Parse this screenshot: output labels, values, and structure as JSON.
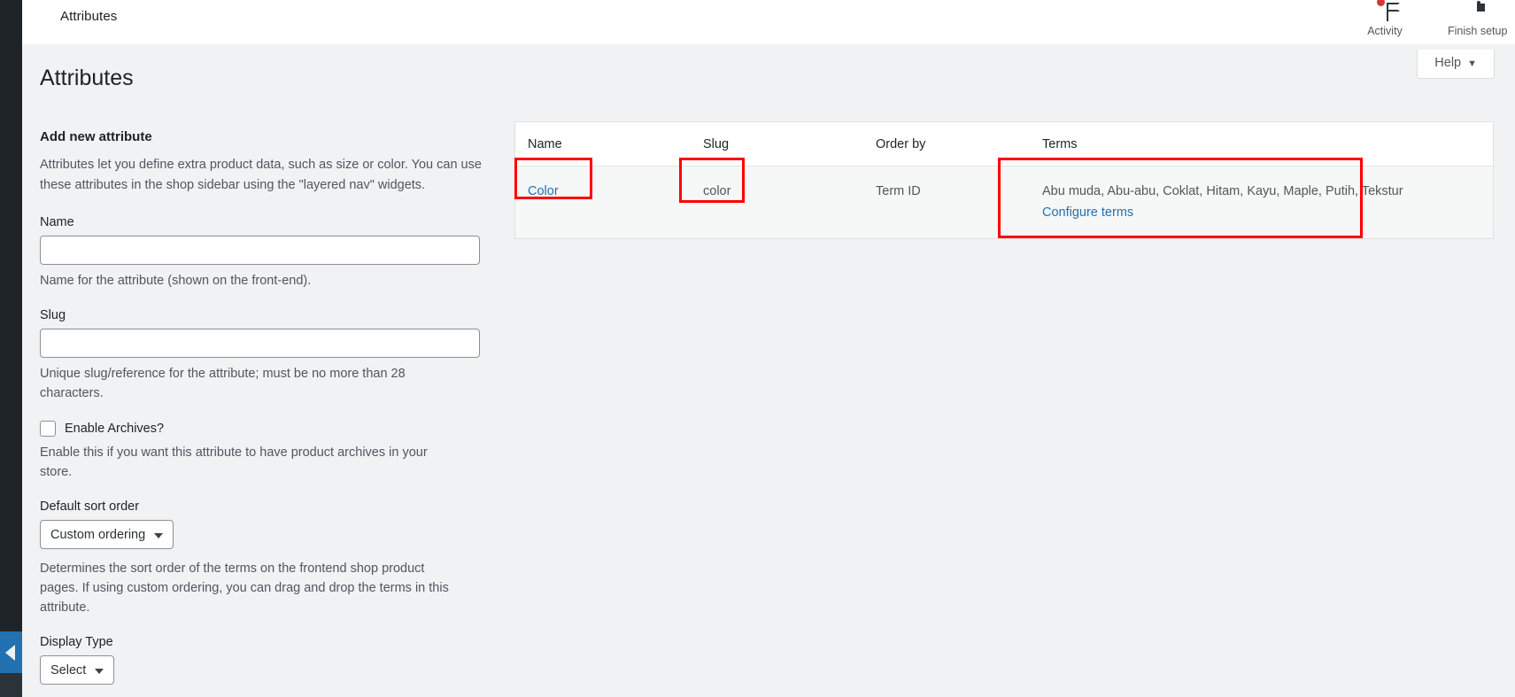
{
  "window": {
    "breadcrumb_title": "Attributes"
  },
  "topbar": {
    "actions": [
      {
        "icon": "flag-icon",
        "label": "Activity",
        "badge": true
      },
      {
        "icon": "setup-progress-icon",
        "label": "Finish setup",
        "badge": false
      }
    ]
  },
  "help": {
    "label": "Help",
    "caret": "▼"
  },
  "page": {
    "title": "Attributes"
  },
  "form": {
    "heading": "Add new attribute",
    "description": "Attributes let you define extra product data, such as size or color. You can use these attributes in the shop sidebar using the \"layered nav\" widgets.",
    "name_label": "Name",
    "name_value": "",
    "name_placeholder": "",
    "name_hint": "Name for the attribute (shown on the front-end).",
    "slug_label": "Slug",
    "slug_value": "",
    "slug_placeholder": "",
    "slug_hint": "Unique slug/reference for the attribute; must be no more than 28 characters.",
    "enable_archives_label": "Enable Archives?",
    "enable_archives_checked": false,
    "enable_archives_hint": "Enable this if you want this attribute to have product archives in your store.",
    "sort_order_label": "Default sort order",
    "sort_order_value": "Custom ordering",
    "sort_order_hint": "Determines the sort order of the terms on the frontend shop product pages. If using custom ordering, you can drag and drop the terms in this attribute.",
    "display_type_label": "Display Type",
    "display_type_value": "Select"
  },
  "table": {
    "headers": {
      "name": "Name",
      "slug": "Slug",
      "order_by": "Order by",
      "terms": "Terms"
    },
    "rows": [
      {
        "name": "Color",
        "slug": "color",
        "order_by": "Term ID",
        "terms": "Abu muda, Abu-abu, Coklat, Hitam, Kayu, Maple, Putih, Tekstur",
        "configure_label": "Configure terms"
      }
    ]
  },
  "colors": {
    "link": "#2271b1",
    "annotation": "#ff0000",
    "admin_rail": "#1d2327",
    "collapse_button": "#2271b1",
    "badge": "#d63638",
    "page_background": "#f0f2f4"
  }
}
